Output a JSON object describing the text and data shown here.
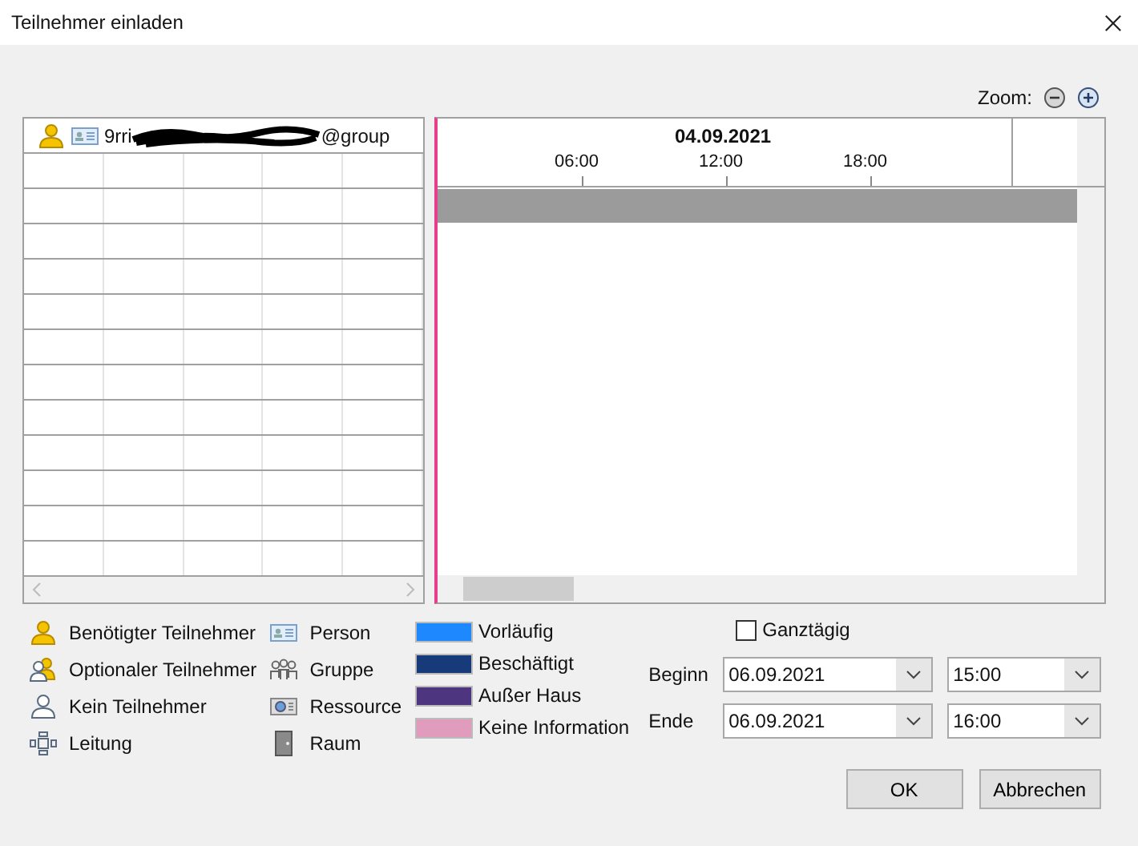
{
  "window": {
    "title": "Teilnehmer einladen"
  },
  "zoom": {
    "label": "Zoom:"
  },
  "attendees": [
    {
      "kind": "required",
      "name_start": "9rri",
      "name_end": "@group"
    }
  ],
  "timeline": {
    "date": "04.09.2021",
    "hours": [
      "06:00",
      "12:00",
      "18:00"
    ]
  },
  "legend_roles": [
    {
      "kind": "required",
      "label": "Benötigter Teilnehmer"
    },
    {
      "kind": "optional",
      "label": "Optionaler Teilnehmer"
    },
    {
      "kind": "none",
      "label": "Kein Teilnehmer"
    },
    {
      "kind": "lead",
      "label": "Leitung"
    }
  ],
  "legend_types": [
    {
      "kind": "person",
      "label": "Person"
    },
    {
      "kind": "group",
      "label": "Gruppe"
    },
    {
      "kind": "resource",
      "label": "Ressource"
    },
    {
      "kind": "room",
      "label": "Raum"
    }
  ],
  "legend_status": [
    {
      "label": "Vorläufig",
      "color": "#1e88ff"
    },
    {
      "label": "Beschäftigt",
      "color": "#173a7a"
    },
    {
      "label": "Außer Haus",
      "color": "#4e3580"
    },
    {
      "label": "Keine Information",
      "color": "#e09bbd"
    }
  ],
  "all_day": {
    "label": "Ganztägig",
    "checked": false
  },
  "start": {
    "label": "Beginn",
    "date": "06.09.2021",
    "time": "15:00"
  },
  "end": {
    "label": "Ende",
    "date": "06.09.2021",
    "time": "16:00"
  },
  "buttons": [
    "OK",
    "Abbrechen"
  ]
}
